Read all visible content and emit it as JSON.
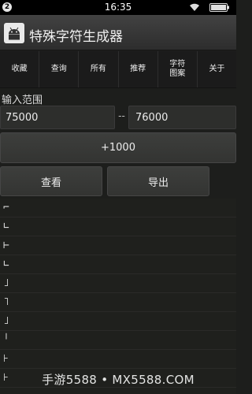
{
  "status_bar": {
    "badge": "2",
    "time": "16:35"
  },
  "app": {
    "title": "特殊字符生成器"
  },
  "tabs": [
    {
      "label": "收藏"
    },
    {
      "label": "查询"
    },
    {
      "label": "所有"
    },
    {
      "label": "推荐"
    },
    {
      "label": "字符\n图案"
    },
    {
      "label": "关于"
    }
  ],
  "range": {
    "label": "输入范围",
    "from": "75000",
    "to": "76000",
    "separator": "--"
  },
  "buttons": {
    "plus": "+1000",
    "view": "查看",
    "export": "导出"
  },
  "results": [
    {
      "glyph": "⌐"
    },
    {
      "glyph": "∟"
    },
    {
      "glyph": "⊢"
    },
    {
      "glyph": "∟"
    },
    {
      "glyph": "˩"
    },
    {
      "glyph": "˥"
    },
    {
      "glyph": "˩"
    },
    {
      "glyph": "╵"
    },
    {
      "glyph": "⊦"
    },
    {
      "glyph": "⊦"
    }
  ],
  "watermark": "手游5588 • MX5588.COM"
}
